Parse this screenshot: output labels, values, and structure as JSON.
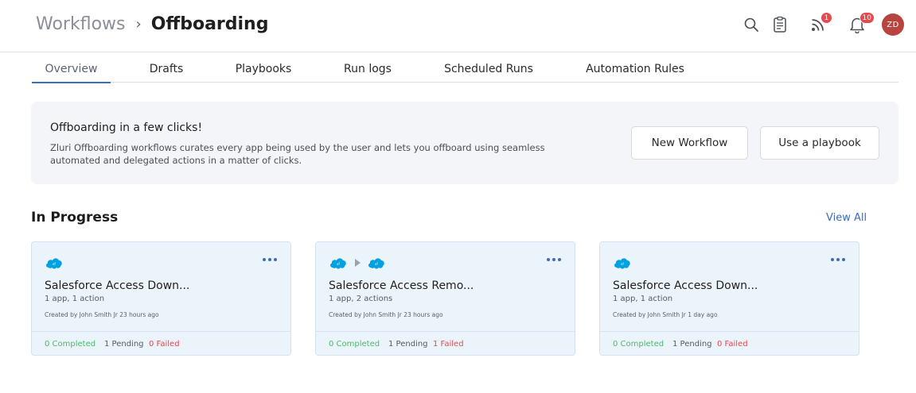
{
  "header": {
    "breadcrumb_root": "Workflows",
    "breadcrumb_separator": "›",
    "breadcrumb_current": "Offboarding",
    "icons": [
      "search-icon",
      "clipboard-icon",
      "rss-feed-icon",
      "bell-icon"
    ],
    "feed_badge": "1",
    "notifications_badge": "10",
    "avatar_initials": "ZD"
  },
  "tabs": [
    {
      "label": "Overview",
      "active": true
    },
    {
      "label": "Drafts"
    },
    {
      "label": "Playbooks"
    },
    {
      "label": "Run logs"
    },
    {
      "label": "Scheduled Runs"
    },
    {
      "label": "Automation Rules"
    }
  ],
  "banner": {
    "title": "Offboarding in a few clicks!",
    "description": "Zluri Offboarding workflows curates every app being used by the user and lets you offboard using seamless automated and delegated actions in a matter of clicks.",
    "new_workflow_label": "New Workflow",
    "use_playbook_label": "Use a playbook"
  },
  "in_progress": {
    "title": "In Progress",
    "view_all_label": "View All",
    "cards": [
      {
        "title": "Salesforce Access Down...",
        "subtitle": "1 app, 1 action",
        "created": "Created by John Smith Jr 23 hours ago",
        "completed": "0 Completed",
        "pending": "1 Pending",
        "failed": "0 Failed",
        "app_icons": [
          "salesforce-logo"
        ]
      },
      {
        "title": "Salesforce Access Remo...",
        "subtitle": "1 app, 2 actions",
        "created": "Created by John Smith Jr 23 hours ago",
        "completed": "0 Completed",
        "pending": "1 Pending",
        "failed": "1 Failed",
        "app_icons": [
          "salesforce-logo",
          "salesforce-logo"
        ]
      },
      {
        "title": "Salesforce Access Down...",
        "subtitle": "1 app, 1 action",
        "created": "Created by John Smith Jr 1 day ago",
        "completed": "0 Completed",
        "pending": "1 Pending",
        "failed": "0 Failed",
        "app_icons": [
          "salesforce-logo"
        ]
      }
    ]
  },
  "colors": {
    "accent": "#3a6bbf",
    "completed": "#4cb86a",
    "failed": "#e5484d",
    "badge": "#e5484d",
    "avatar": "#b8433f",
    "card_bg": "#ecf4fb",
    "salesforce": "#00a1e0"
  }
}
